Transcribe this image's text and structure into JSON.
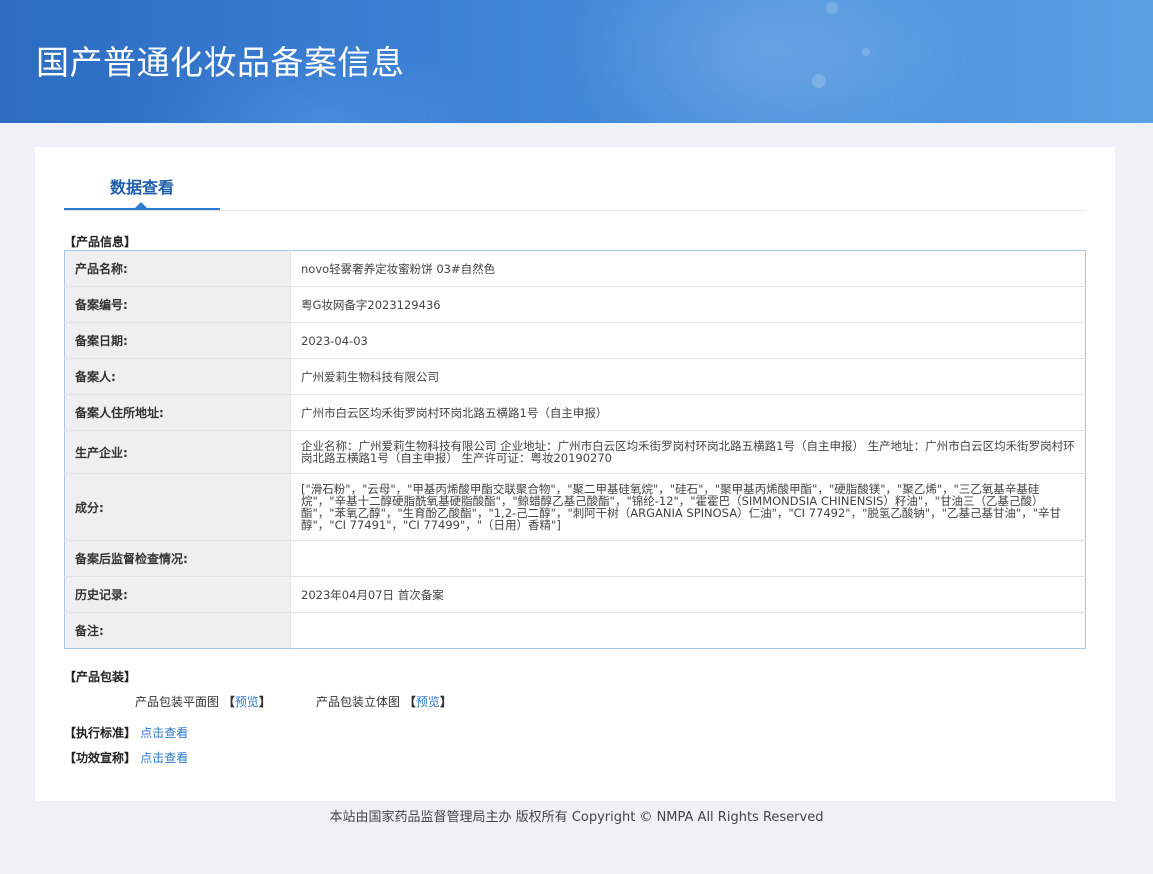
{
  "header": {
    "title": "国产普通化妆品备案信息"
  },
  "tabs": {
    "active_label": "数据查看"
  },
  "product_info": {
    "section_label": "【产品信息】",
    "rows": [
      {
        "label": "产品名称:",
        "value": "novo轻雾奢养定妆蜜粉饼 03#自然色"
      },
      {
        "label": "备案编号:",
        "value": "粤G妆网备字2023129436"
      },
      {
        "label": "备案日期:",
        "value": "2023-04-03"
      },
      {
        "label": "备案人:",
        "value": "广州爱莉生物科技有限公司"
      },
      {
        "label": "备案人住所地址:",
        "value": "广州市白云区均禾街罗岗村环岗北路五横路1号（自主申报）"
      },
      {
        "label": "生产企业:",
        "value": "企业名称：广州爱莉生物科技有限公司 企业地址：广州市白云区均禾街罗岗村环岗北路五横路1号（自主申报） 生产地址：广州市白云区均禾街罗岗村环岗北路五横路1号（自主申报） 生产许可证：粤妆20190270"
      },
      {
        "label": "成分:",
        "value": "[\"滑石粉\"，\"云母\"，\"甲基丙烯酸甲酯交联聚合物\"，\"聚二甲基硅氧烷\"，\"硅石\"，\"聚甲基丙烯酸甲酯\"，\"硬脂酸镁\"，\"聚乙烯\"，\"三乙氧基辛基硅烷\"，\"辛基十二醇硬脂酰氧基硬脂酸酯\"，\"鲸蜡醇乙基己酸酯\"，\"锦纶-12\"，\"霍霍巴（SIMMONDSIA CHINENSIS）籽油\"，\"甘油三（乙基己酸）酯\"，\"苯氧乙醇\"，\"生育酚乙酸酯\"，\"1,2-己二醇\"，\"刺阿干树（ARGANIA SPINOSA）仁油\"，\"CI 77492\"，\"脱氢乙酸钠\"，\"乙基己基甘油\"，\"辛甘醇\"，\"CI 77491\"，\"CI 77499\"，\"（日用）香精\"]"
      },
      {
        "label": "备案后监督检查情况:",
        "value": ""
      },
      {
        "label": "历史记录:",
        "value": "2023年04月07日 首次备案"
      },
      {
        "label": "备注:",
        "value": ""
      }
    ]
  },
  "packaging": {
    "section_label": "【产品包装】",
    "flat_label": "产品包装平面图",
    "flat_open": "【",
    "flat_link": "预览",
    "flat_close": "】",
    "solid_label": "产品包装立体图",
    "solid_open": "【",
    "solid_link": "预览",
    "solid_close": "】"
  },
  "standard": {
    "section_label": "【执行标准】",
    "link": "点击查看"
  },
  "efficacy": {
    "section_label": "【功效宣称】",
    "link": "点击查看"
  },
  "footer": {
    "text": "本站由国家药品监督管理局主办 版权所有 Copyright © NMPA All Rights Reserved"
  }
}
